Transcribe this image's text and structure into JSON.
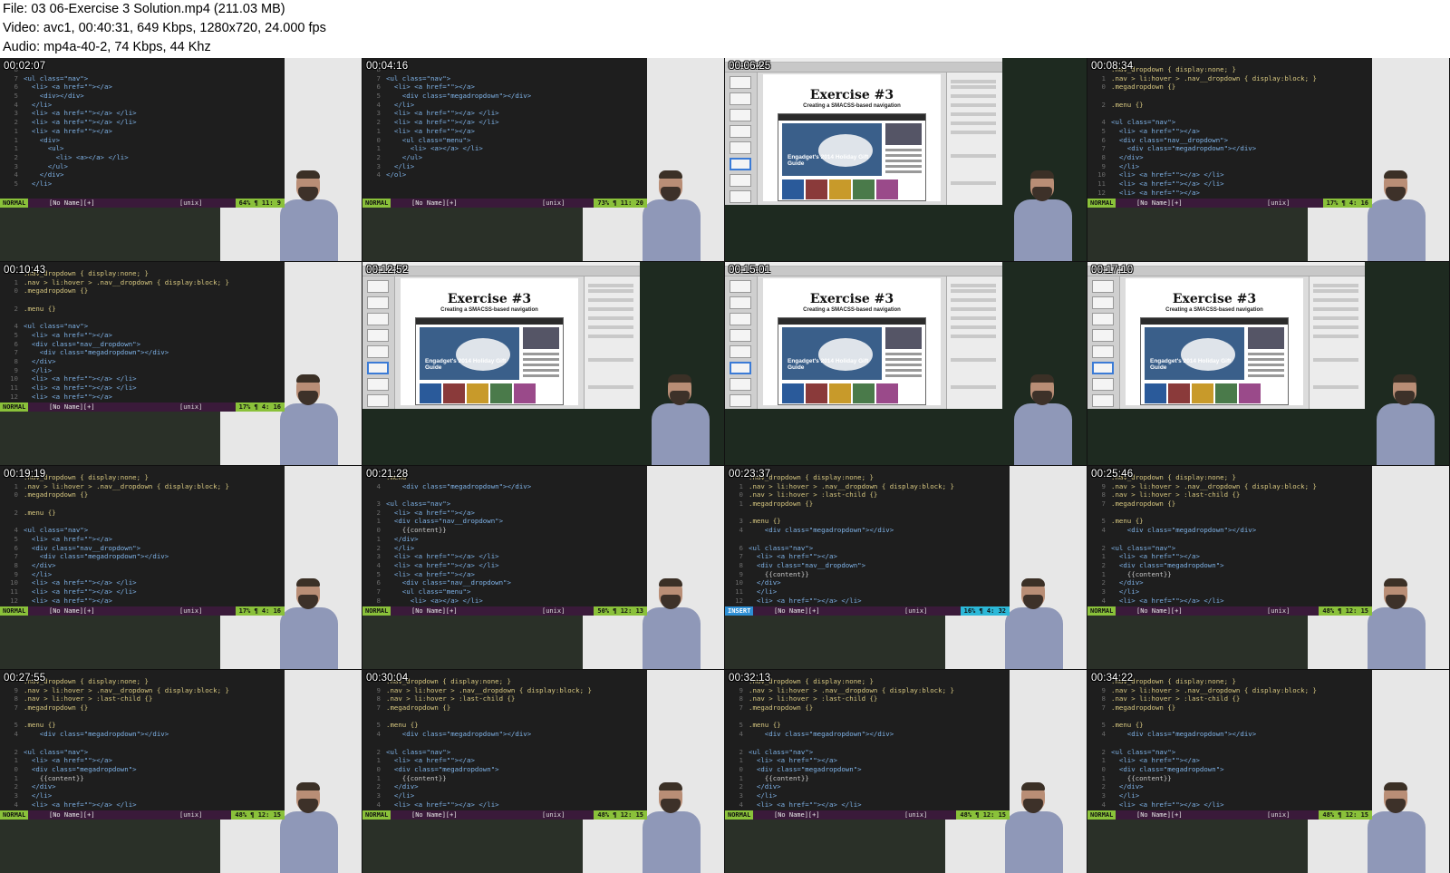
{
  "header": {
    "file_line": "File: 03 06-Exercise 3 Solution.mp4 (211.03 MB)",
    "video_line": "Video: avc1, 00:40:31, 649 Kbps, 1280x720, 24.000 fps",
    "audio_line": "Audio: mp4a-40-2, 74 Kbps, 44 Khz"
  },
  "slide": {
    "title": "Exercise #3",
    "subtitle": "Creating a SMACSS-based navigation",
    "hero_caption": "Engadget's 2014 Holiday Gift Guide"
  },
  "frames": [
    {
      "time": "00:02:07",
      "kind": "code",
      "mode": "NORMAL",
      "file": "[No Name][+]",
      "fmt": "[unix]",
      "pos": "64% ¶  11:  9",
      "lines": [
        {
          "n": "8",
          "t": ""
        },
        {
          "n": "7",
          "t": "<ul class=\"nav\">"
        },
        {
          "n": "6",
          "t": "  <li> <a href=\"\"></a>"
        },
        {
          "n": "5",
          "t": "    <div></div>"
        },
        {
          "n": "4",
          "t": "  </li>"
        },
        {
          "n": "3",
          "t": "  <li> <a href=\"\"></a> </li>"
        },
        {
          "n": "2",
          "t": "  <li> <a href=\"\"></a> </li>"
        },
        {
          "n": "1",
          "t": "  <li> <a href=\"\"></a>"
        },
        {
          "n": "1",
          "t": "    <div>"
        },
        {
          "n": "1",
          "t": "      <ul>"
        },
        {
          "n": "2",
          "t": "        <li> <a></a> </li>"
        },
        {
          "n": "3",
          "t": "      </ul>"
        },
        {
          "n": "4",
          "t": "    </div>"
        },
        {
          "n": "5",
          "t": "  </li>"
        }
      ]
    },
    {
      "time": "00:04:16",
      "kind": "code",
      "mode": "NORMAL",
      "file": "[No Name][+]",
      "fmt": "[unix]",
      "pos": "73% ¶  11: 20",
      "lines": [
        {
          "n": "8",
          "t": ""
        },
        {
          "n": "7",
          "t": "<ul class=\"nav\">"
        },
        {
          "n": "6",
          "t": "  <li> <a href=\"\"></a>"
        },
        {
          "n": "5",
          "t": "    <div class=\"megadropdown\"></div>"
        },
        {
          "n": "4",
          "t": "  </li>"
        },
        {
          "n": "3",
          "t": "  <li> <a href=\"\"></a> </li>"
        },
        {
          "n": "2",
          "t": "  <li> <a href=\"\"></a> </li>"
        },
        {
          "n": "1",
          "t": "  <li> <a href=\"\"></a>"
        },
        {
          "n": "0",
          "t": "    <ul class=\"menu\">"
        },
        {
          "n": "1",
          "t": "      <li> <a></a> </li>"
        },
        {
          "n": "2",
          "t": "    </ul>"
        },
        {
          "n": "3",
          "t": "  </li>"
        },
        {
          "n": "4",
          "t": "</ol>"
        }
      ]
    },
    {
      "time": "00:06:25",
      "kind": "slide"
    },
    {
      "time": "00:08:34",
      "kind": "code",
      "mode": "NORMAL",
      "file": "[No Name][+]",
      "fmt": "[unix]",
      "pos": "17% ¶   4: 16",
      "lines": [
        {
          "n": "",
          "t": ".nav_dropdown { display:none; }"
        },
        {
          "n": "1",
          "t": ".nav > li:hover > .nav__dropdown { display:block; }"
        },
        {
          "n": "0",
          "t": ".megadropdown {}"
        },
        {
          "n": "",
          "t": ""
        },
        {
          "n": "2",
          "t": ".menu {}"
        },
        {
          "n": "",
          "t": ""
        },
        {
          "n": "4",
          "t": "<ul class=\"nav\">"
        },
        {
          "n": "5",
          "t": "  <li> <a href=\"\"></a>"
        },
        {
          "n": "6",
          "t": "  <div class=\"nav__dropdown\">"
        },
        {
          "n": "7",
          "t": "    <div class=\"megadropdown\"></div>"
        },
        {
          "n": "8",
          "t": "  </div>"
        },
        {
          "n": "9",
          "t": "  </li>"
        },
        {
          "n": "10",
          "t": "  <li> <a href=\"\"></a> </li>"
        },
        {
          "n": "11",
          "t": "  <li> <a href=\"\"></a> </li>"
        },
        {
          "n": "12",
          "t": "  <li> <a href=\"\"></a>"
        }
      ]
    },
    {
      "time": "00:10:43",
      "kind": "code",
      "mode": "NORMAL",
      "file": "[No Name][+]",
      "fmt": "[unix]",
      "pos": "17% ¶   4: 16",
      "lines": [
        {
          "n": "",
          "t": ".nav_dropdown { display:none; }"
        },
        {
          "n": "1",
          "t": ".nav > li:hover > .nav__dropdown { display:block; }"
        },
        {
          "n": "0",
          "t": ".megadropdown {}"
        },
        {
          "n": "",
          "t": ""
        },
        {
          "n": "2",
          "t": ".menu {}"
        },
        {
          "n": "",
          "t": ""
        },
        {
          "n": "4",
          "t": "<ul class=\"nav\">"
        },
        {
          "n": "5",
          "t": "  <li> <a href=\"\"></a>"
        },
        {
          "n": "6",
          "t": "  <div class=\"nav__dropdown\">"
        },
        {
          "n": "7",
          "t": "    <div class=\"megadropdown\"></div>"
        },
        {
          "n": "8",
          "t": "  </div>"
        },
        {
          "n": "9",
          "t": "  </li>"
        },
        {
          "n": "10",
          "t": "  <li> <a href=\"\"></a> </li>"
        },
        {
          "n": "11",
          "t": "  <li> <a href=\"\"></a> </li>"
        },
        {
          "n": "12",
          "t": "  <li> <a href=\"\"></a>"
        }
      ]
    },
    {
      "time": "00:12:52",
      "kind": "slide"
    },
    {
      "time": "00:15:01",
      "kind": "slide"
    },
    {
      "time": "00:17:10",
      "kind": "slide"
    },
    {
      "time": "00:19:19",
      "kind": "code",
      "mode": "NORMAL",
      "file": "[No Name][+]",
      "fmt": "[unix]",
      "pos": "17% ¶   4: 16",
      "lines": [
        {
          "n": "",
          "t": ".nav_dropdown { display:none; }"
        },
        {
          "n": "1",
          "t": ".nav > li:hover > .nav__dropdown { display:block; }"
        },
        {
          "n": "0",
          "t": ".megadropdown {}"
        },
        {
          "n": "",
          "t": ""
        },
        {
          "n": "2",
          "t": ".menu {}"
        },
        {
          "n": "",
          "t": ""
        },
        {
          "n": "4",
          "t": "<ul class=\"nav\">"
        },
        {
          "n": "5",
          "t": "  <li> <a href=\"\"></a>"
        },
        {
          "n": "6",
          "t": "  <div class=\"nav__dropdown\">"
        },
        {
          "n": "7",
          "t": "    <div class=\"megadropdown\"></div>"
        },
        {
          "n": "8",
          "t": "  </div>"
        },
        {
          "n": "9",
          "t": "  </li>"
        },
        {
          "n": "10",
          "t": "  <li> <a href=\"\"></a> </li>"
        },
        {
          "n": "11",
          "t": "  <li> <a href=\"\"></a> </li>"
        },
        {
          "n": "12",
          "t": "  <li> <a href=\"\"></a>"
        }
      ]
    },
    {
      "time": "00:21:28",
      "kind": "code",
      "mode": "NORMAL",
      "file": "[No Name][+]",
      "fmt": "[unix]",
      "pos": "50% ¶  12: 13",
      "lines": [
        {
          "n": "",
          "t": ".menu"
        },
        {
          "n": "4",
          "t": "    <div class=\"megadropdown\"></div>"
        },
        {
          "n": "",
          "t": ""
        },
        {
          "n": "3",
          "t": "<ul class=\"nav\">"
        },
        {
          "n": "2",
          "t": "  <li> <a href=\"\"></a>"
        },
        {
          "n": "1",
          "t": "  <div class=\"nav__dropdown\">"
        },
        {
          "n": "0",
          "t": "    {{content}}"
        },
        {
          "n": "1",
          "t": "  </div>"
        },
        {
          "n": "2",
          "t": "  </li>"
        },
        {
          "n": "3",
          "t": "  <li> <a href=\"\"></a> </li>"
        },
        {
          "n": "4",
          "t": "  <li> <a href=\"\"></a> </li>"
        },
        {
          "n": "5",
          "t": "  <li> <a href=\"\"></a>"
        },
        {
          "n": "6",
          "t": "    <div class=\"nav__dropdown\">"
        },
        {
          "n": "7",
          "t": "    <ul class=\"menu\">"
        },
        {
          "n": "8",
          "t": "      <li> <a></a> </li>"
        }
      ]
    },
    {
      "time": "00:23:37",
      "kind": "code",
      "mode": "INSERT",
      "file": "[No Name][+]",
      "fmt": "[unix]",
      "pos": "16% ¶   4: 32",
      "lines": [
        {
          "n": "",
          "t": ".nav_dropdown { display:none; }"
        },
        {
          "n": "1",
          "t": ".nav > li:hover > .nav__dropdown { display:block; }"
        },
        {
          "n": "0",
          "t": ".nav > li:hover > :last-child {}"
        },
        {
          "n": "1",
          "t": ".megadropdown {}"
        },
        {
          "n": "",
          "t": ""
        },
        {
          "n": "3",
          "t": ".menu {}"
        },
        {
          "n": "4",
          "t": "    <div class=\"megadropdown\"></div>"
        },
        {
          "n": "",
          "t": ""
        },
        {
          "n": "6",
          "t": "<ul class=\"nav\">"
        },
        {
          "n": "7",
          "t": "  <li> <a href=\"\"></a>"
        },
        {
          "n": "8",
          "t": "  <div class=\"nav__dropdown\">"
        },
        {
          "n": "9",
          "t": "    {{content}}"
        },
        {
          "n": "10",
          "t": "  </div>"
        },
        {
          "n": "11",
          "t": "  </li>"
        },
        {
          "n": "12",
          "t": "  <li> <a href=\"\"></a> </li>"
        }
      ]
    },
    {
      "time": "00:25:46",
      "kind": "code",
      "mode": "NORMAL",
      "file": "[No Name][+]",
      "fmt": "[unix]",
      "pos": "48% ¶  12: 15",
      "lines": [
        {
          "n": "",
          "t": ".nav_dropdown { display:none; }"
        },
        {
          "n": "9",
          "t": ".nav > li:hover > .nav__dropdown { display:block; }"
        },
        {
          "n": "8",
          "t": ".nav > li:hover > :last-child {}"
        },
        {
          "n": "7",
          "t": ".megadropdown {}"
        },
        {
          "n": "",
          "t": ""
        },
        {
          "n": "5",
          "t": ".menu {}"
        },
        {
          "n": "4",
          "t": "    <div class=\"megadropdown\"></div>"
        },
        {
          "n": "",
          "t": ""
        },
        {
          "n": "2",
          "t": "<ul class=\"nav\">"
        },
        {
          "n": "1",
          "t": "  <li> <a href=\"\"></a>"
        },
        {
          "n": "2",
          "t": "  <div class=\"megadropdown\">"
        },
        {
          "n": "1",
          "t": "    {{content}}"
        },
        {
          "n": "2",
          "t": "  </div>"
        },
        {
          "n": "3",
          "t": "  </li>"
        },
        {
          "n": "4",
          "t": "  <li> <a href=\"\"></a> </li>"
        }
      ]
    },
    {
      "time": "00:27:55",
      "kind": "code",
      "mode": "NORMAL",
      "file": "[No Name][+]",
      "fmt": "[unix]",
      "pos": "48% ¶  12: 15",
      "lines": [
        {
          "n": "",
          "t": ".nav_dropdown { display:none; }"
        },
        {
          "n": "9",
          "t": ".nav > li:hover > .nav__dropdown { display:block; }"
        },
        {
          "n": "8",
          "t": ".nav > li:hover > :last-child {}"
        },
        {
          "n": "7",
          "t": ".megadropdown {}"
        },
        {
          "n": "",
          "t": ""
        },
        {
          "n": "5",
          "t": ".menu {}"
        },
        {
          "n": "4",
          "t": "    <div class=\"megadropdown\"></div>"
        },
        {
          "n": "",
          "t": ""
        },
        {
          "n": "2",
          "t": "<ul class=\"nav\">"
        },
        {
          "n": "1",
          "t": "  <li> <a href=\"\"></a>"
        },
        {
          "n": "0",
          "t": "  <div class=\"megadropdown\">"
        },
        {
          "n": "1",
          "t": "    {{content}}"
        },
        {
          "n": "2",
          "t": "  </div>"
        },
        {
          "n": "3",
          "t": "  </li>"
        },
        {
          "n": "4",
          "t": "  <li> <a href=\"\"></a> </li>"
        }
      ]
    },
    {
      "time": "00:30:04",
      "kind": "code",
      "mode": "NORMAL",
      "file": "[No Name][+]",
      "fmt": "[unix]",
      "pos": "48% ¶  12: 15",
      "lines": [
        {
          "n": "",
          "t": ".nav_dropdown { display:none; }"
        },
        {
          "n": "9",
          "t": ".nav > li:hover > .nav__dropdown { display:block; }"
        },
        {
          "n": "8",
          "t": ".nav > li:hover > :last-child {}"
        },
        {
          "n": "7",
          "t": ".megadropdown {}"
        },
        {
          "n": "",
          "t": ""
        },
        {
          "n": "5",
          "t": ".menu {}"
        },
        {
          "n": "4",
          "t": "    <div class=\"megadropdown\"></div>"
        },
        {
          "n": "",
          "t": ""
        },
        {
          "n": "2",
          "t": "<ul class=\"nav\">"
        },
        {
          "n": "1",
          "t": "  <li> <a href=\"\"></a>"
        },
        {
          "n": "0",
          "t": "  <div class=\"megadropdown\">"
        },
        {
          "n": "1",
          "t": "    {{content}}"
        },
        {
          "n": "2",
          "t": "  </div>"
        },
        {
          "n": "3",
          "t": "  </li>"
        },
        {
          "n": "4",
          "t": "  <li> <a href=\"\"></a> </li>"
        }
      ]
    },
    {
      "time": "00:32:13",
      "kind": "code",
      "mode": "NORMAL",
      "file": "[No Name][+]",
      "fmt": "[unix]",
      "pos": "48% ¶  12: 15",
      "lines": [
        {
          "n": "",
          "t": ".nav_dropdown { display:none; }"
        },
        {
          "n": "9",
          "t": ".nav > li:hover > .nav__dropdown { display:block; }"
        },
        {
          "n": "8",
          "t": ".nav > li:hover > :last-child {}"
        },
        {
          "n": "7",
          "t": ".megadropdown {}"
        },
        {
          "n": "",
          "t": ""
        },
        {
          "n": "5",
          "t": ".menu {}"
        },
        {
          "n": "4",
          "t": "    <div class=\"megadropdown\"></div>"
        },
        {
          "n": "",
          "t": ""
        },
        {
          "n": "2",
          "t": "<ul class=\"nav\">"
        },
        {
          "n": "1",
          "t": "  <li> <a href=\"\"></a>"
        },
        {
          "n": "0",
          "t": "  <div class=\"megadropdown\">"
        },
        {
          "n": "1",
          "t": "    {{content}}"
        },
        {
          "n": "2",
          "t": "  </div>"
        },
        {
          "n": "3",
          "t": "  </li>"
        },
        {
          "n": "4",
          "t": "  <li> <a href=\"\"></a> </li>"
        }
      ]
    },
    {
      "time": "00:34:22",
      "kind": "code",
      "mode": "NORMAL",
      "file": "[No Name][+]",
      "fmt": "[unix]",
      "pos": "48% ¶  12: 15",
      "lines": [
        {
          "n": "",
          "t": ".nav_dropdown { display:none; }"
        },
        {
          "n": "9",
          "t": ".nav > li:hover > .nav__dropdown { display:block; }"
        },
        {
          "n": "8",
          "t": ".nav > li:hover > :last-child {}"
        },
        {
          "n": "7",
          "t": ".megadropdown {}"
        },
        {
          "n": "",
          "t": ""
        },
        {
          "n": "5",
          "t": ".menu {}"
        },
        {
          "n": "4",
          "t": "    <div class=\"megadropdown\"></div>"
        },
        {
          "n": "",
          "t": ""
        },
        {
          "n": "2",
          "t": "<ul class=\"nav\">"
        },
        {
          "n": "1",
          "t": "  <li> <a href=\"\"></a>"
        },
        {
          "n": "0",
          "t": "  <div class=\"megadropdown\">"
        },
        {
          "n": "1",
          "t": "    {{content}}"
        },
        {
          "n": "2",
          "t": "  </div>"
        },
        {
          "n": "3",
          "t": "  </li>"
        },
        {
          "n": "4",
          "t": "  <li> <a href=\"\"></a> </li>"
        }
      ]
    }
  ]
}
